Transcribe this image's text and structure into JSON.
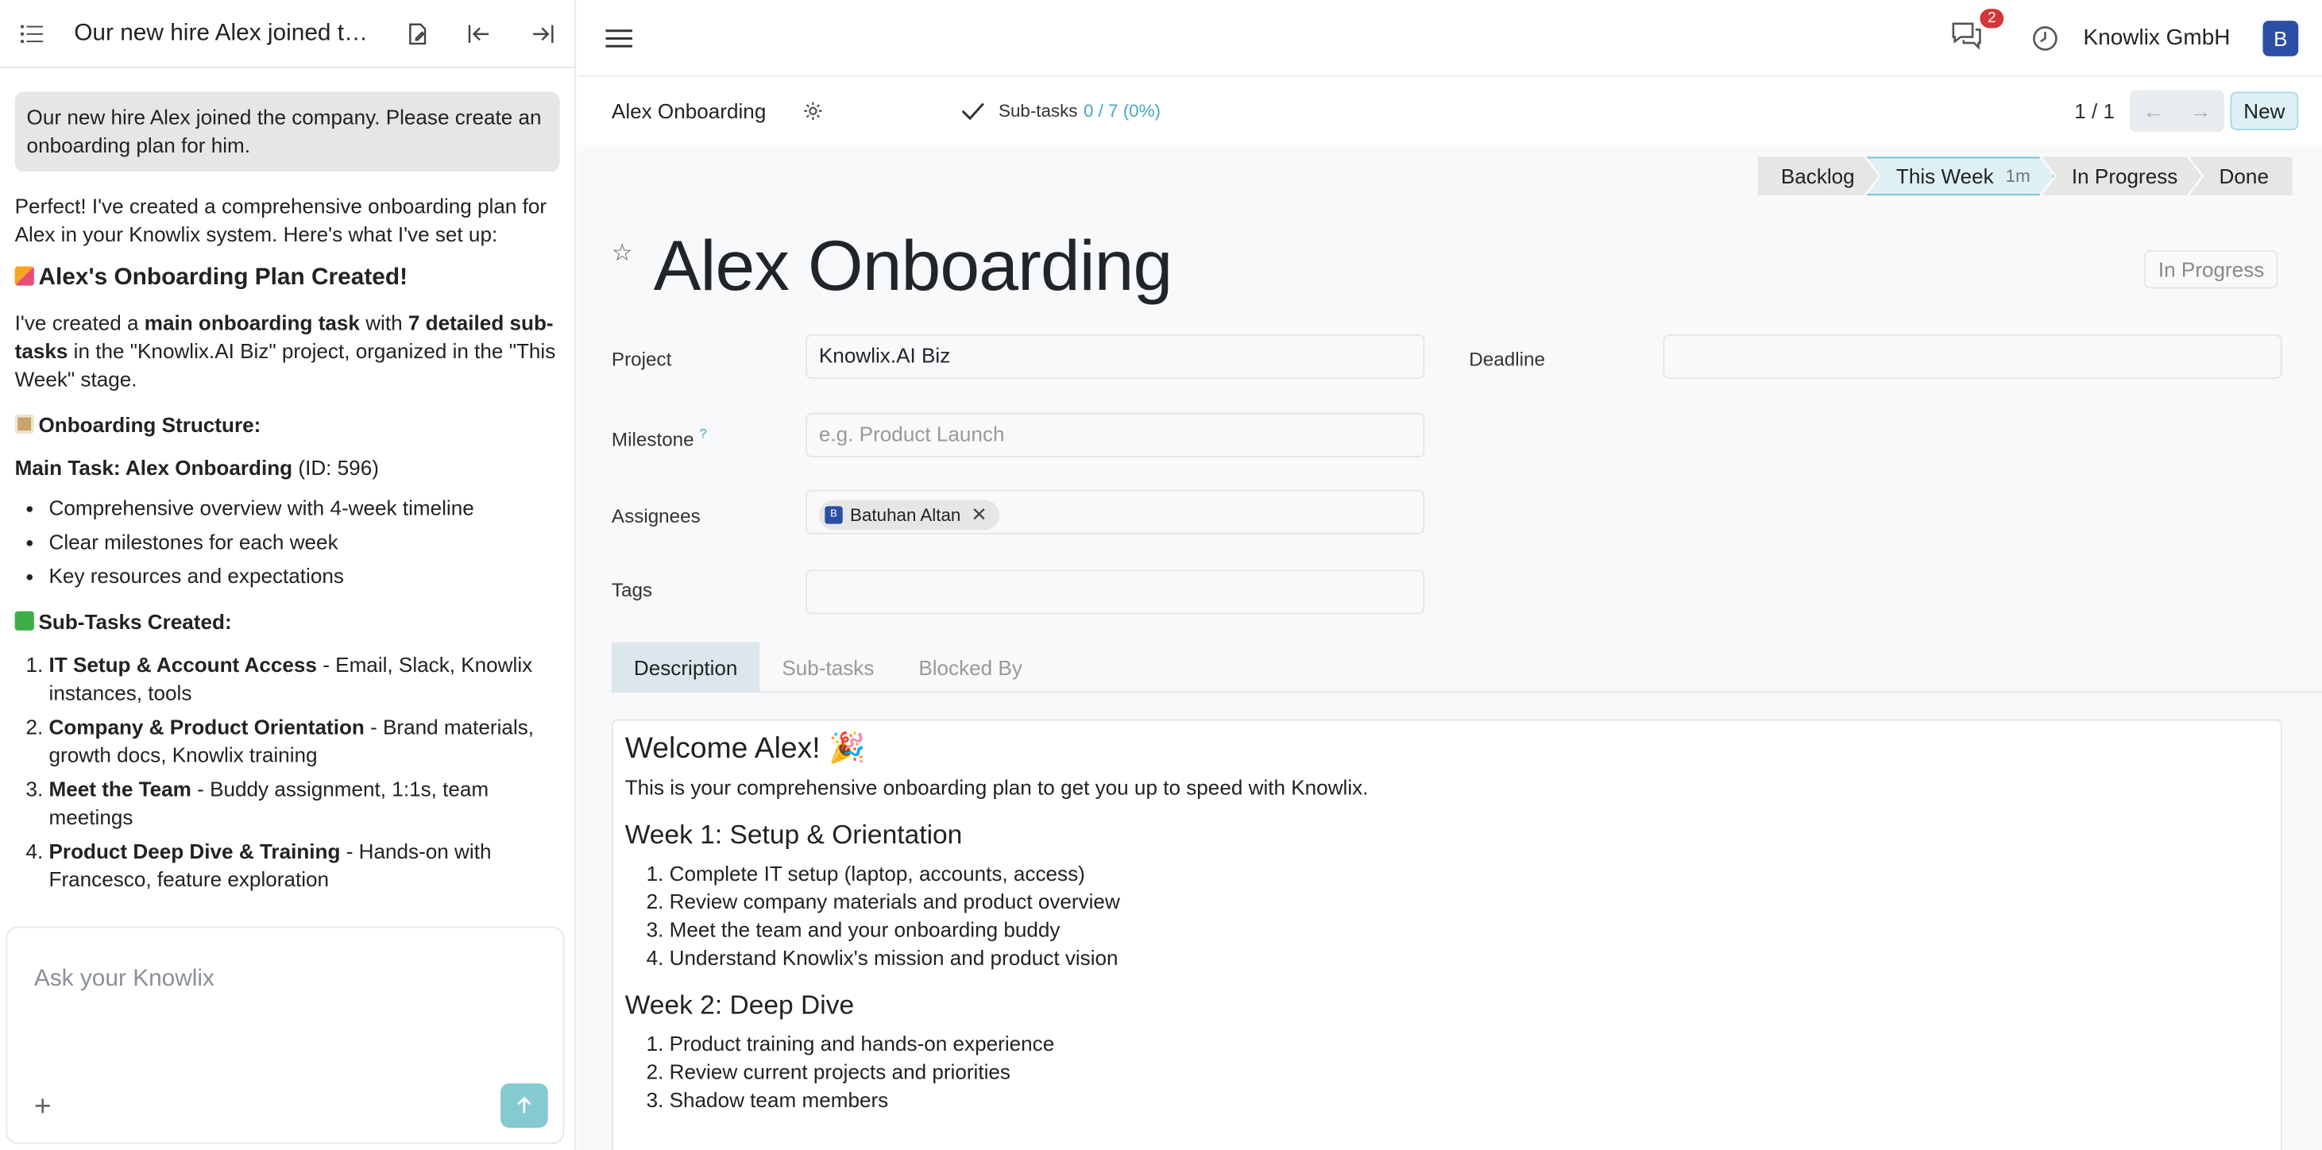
{
  "chat": {
    "header_title": "Our new hire Alex joined th...",
    "user_message": "Our new hire Alex joined the company. Please create an onboarding plan for him.",
    "reply_intro": "Perfect! I've created a comprehensive onboarding plan for Alex in your Knowlix system. Here's what I've set up:",
    "heading_created": "Alex's Onboarding Plan Created!",
    "para_prefix": "I've created a ",
    "para_bold1": "main onboarding task",
    "para_mid": " with ",
    "para_bold2": "7 detailed sub-tasks",
    "para_suffix": " in the \"Knowlix.AI Biz\" project, organized in the \"This Week\" stage.",
    "heading_structure": "Onboarding Structure:",
    "main_task_label": "Main Task: Alex Onboarding",
    "main_task_id": " (ID: 596)",
    "structure_items": [
      "Comprehensive overview with 4-week timeline",
      "Clear milestones for each week",
      "Key resources and expectations"
    ],
    "heading_subtasks": "Sub-Tasks Created:",
    "subtasks": [
      {
        "title": "IT Setup & Account Access",
        "desc": " - Email, Slack, Knowlix instances, tools"
      },
      {
        "title": "Company & Product Orientation",
        "desc": " - Brand materials, growth docs, Knowlix training"
      },
      {
        "title": "Meet the Team",
        "desc": " - Buddy assignment, 1:1s, team meetings"
      },
      {
        "title": "Product Deep Dive & Training",
        "desc": " - Hands-on with Francesco, feature exploration"
      }
    ],
    "input_placeholder": "Ask your Knowlix",
    "plus_label": "+"
  },
  "topbar": {
    "company": "Knowlix GmbH",
    "messages_badge": "2",
    "avatar_letter": "B"
  },
  "control": {
    "breadcrumb": "Alex Onboarding",
    "subtasks_label": "Sub-tasks",
    "subtasks_value": "0 / 7 (0%)",
    "pager": "1 / 1",
    "new_label": "New"
  },
  "stages": [
    {
      "label": "Backlog",
      "active": false
    },
    {
      "label": "This Week",
      "duration": "1m",
      "active": true
    },
    {
      "label": "In Progress",
      "active": false
    },
    {
      "label": "Done",
      "active": false
    }
  ],
  "record": {
    "title": "Alex Onboarding",
    "state": "In Progress",
    "project_label": "Project",
    "project_value": "Knowlix.AI Biz",
    "deadline_label": "Deadline",
    "milestone_label": "Milestone",
    "milestone_help": "?",
    "milestone_placeholder": "e.g. Product Launch",
    "assignees_label": "Assignees",
    "assignee_name": "Batuhan Altan",
    "assignee_initial": "B",
    "tags_label": "Tags"
  },
  "tabs": [
    "Description",
    "Sub-tasks",
    "Blocked By"
  ],
  "description": {
    "heading": "Welcome Alex! 🎉",
    "intro": "This is your comprehensive onboarding plan to get you up to speed with Knowlix.",
    "week1_title": "Week 1: Setup & Orientation",
    "week1_items": [
      "Complete IT setup (laptop, accounts, access)",
      "Review company materials and product overview",
      "Meet the team and your onboarding buddy",
      "Understand Knowlix's mission and product vision"
    ],
    "week2_title": "Week 2: Deep Dive",
    "week2_items": [
      "Product training and hands-on experience",
      "Review current projects and priorities",
      "Shadow team members"
    ]
  },
  "colors": {
    "accent": "#44a9c1",
    "active_stage_bg": "#dff0f4",
    "avatar": "#2c4ea5",
    "badge": "#d63638",
    "send_button": "#85c9d1"
  }
}
